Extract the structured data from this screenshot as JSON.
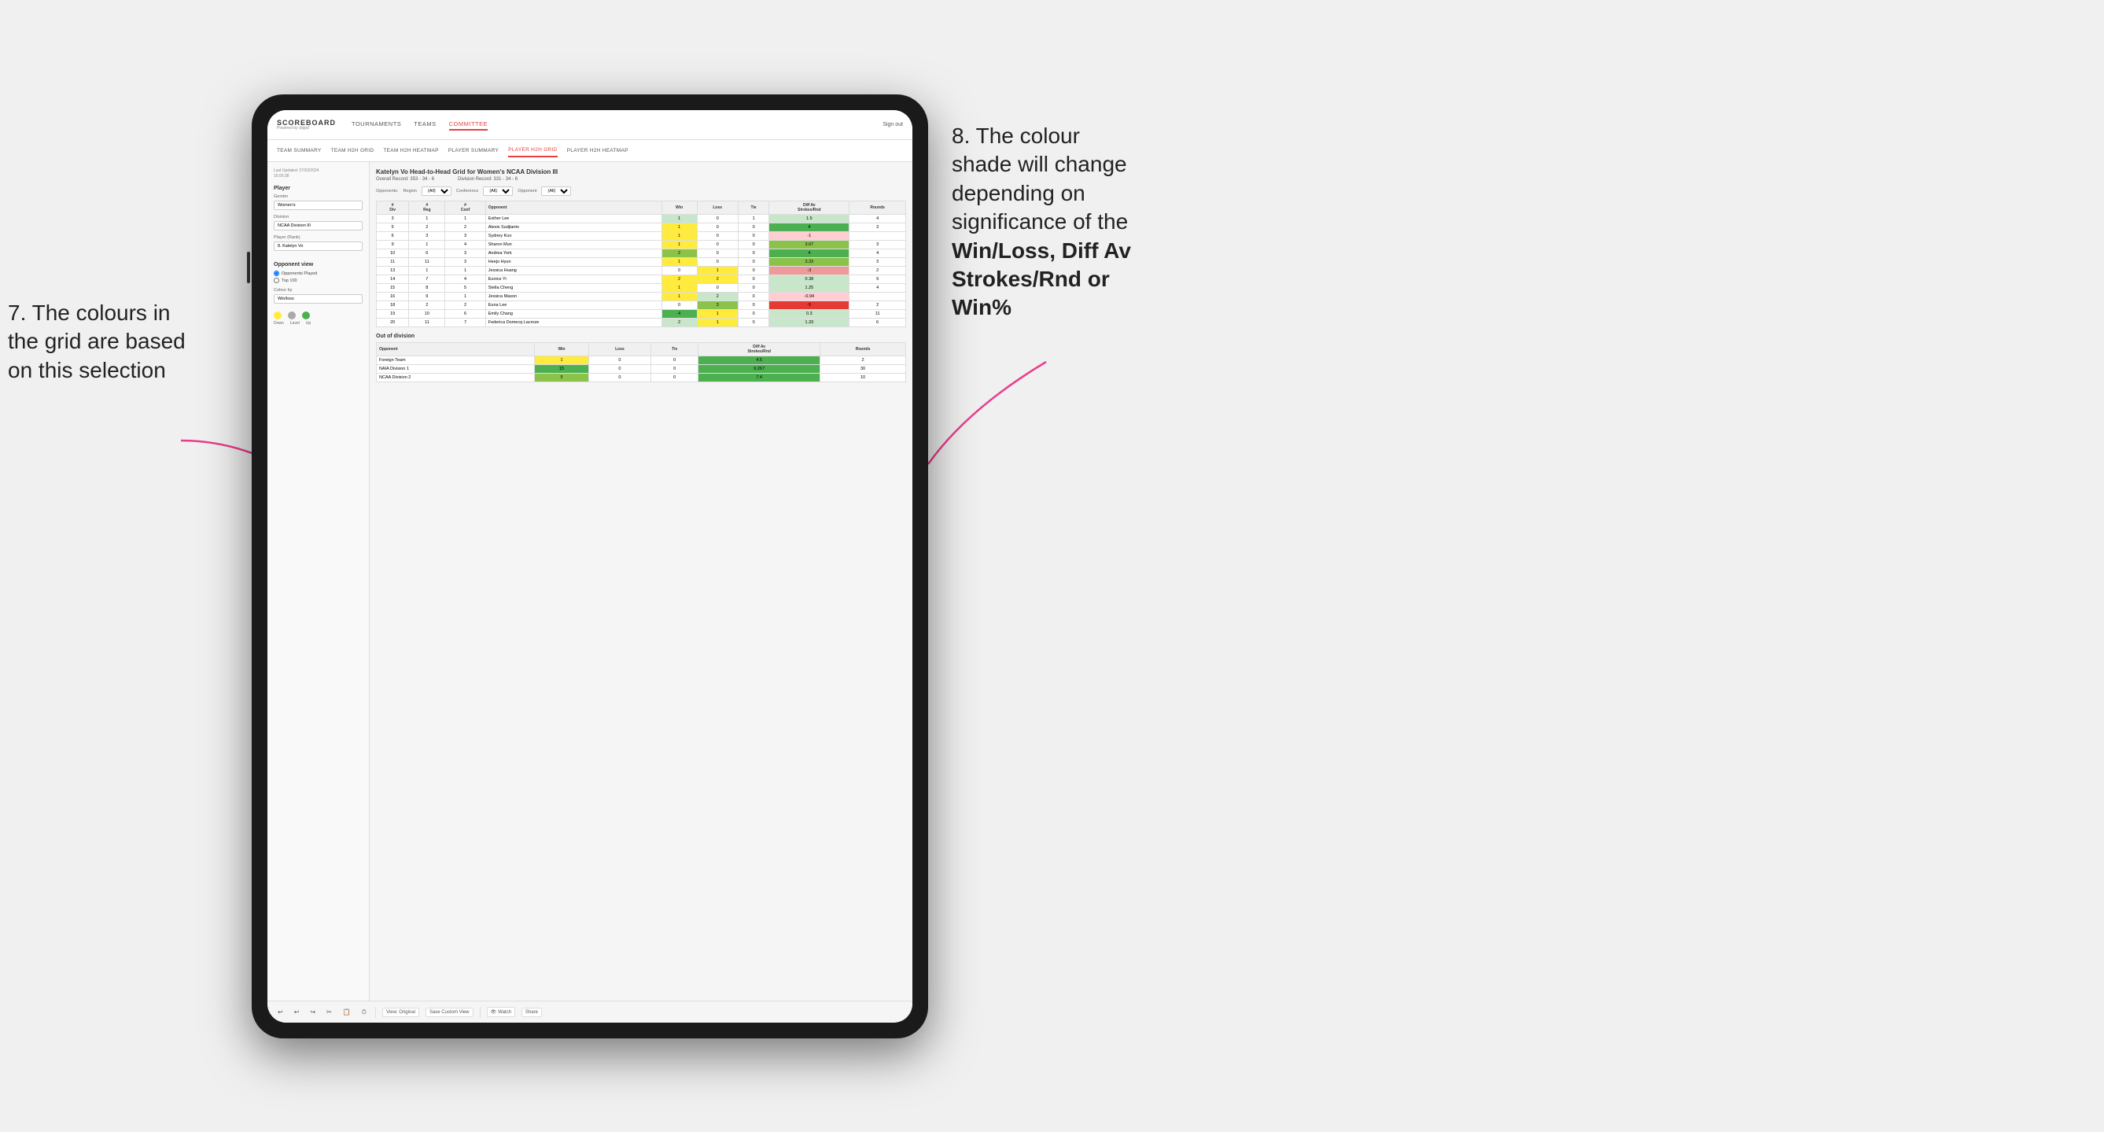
{
  "annotations": {
    "left": {
      "line1": "7. The colours in",
      "line2": "the grid are based",
      "line3": "on this selection"
    },
    "right": {
      "line1": "8. The colour",
      "line2": "shade will change",
      "line3": "depending on",
      "line4": "significance of the",
      "bold1": "Win/Loss",
      "comma": ", ",
      "bold2": "Diff Av",
      "line5": "Strokes/Rnd",
      "or": " or",
      "bold3": "Win%"
    }
  },
  "nav": {
    "logo": "SCOREBOARD",
    "logo_sub": "Powered by clippd",
    "items": [
      "TOURNAMENTS",
      "TEAMS",
      "COMMITTEE"
    ],
    "active": "COMMITTEE",
    "sign_out": "Sign out"
  },
  "sub_nav": {
    "items": [
      "TEAM SUMMARY",
      "TEAM H2H GRID",
      "TEAM H2H HEATMAP",
      "PLAYER SUMMARY",
      "PLAYER H2H GRID",
      "PLAYER H2H HEATMAP"
    ],
    "active": "PLAYER H2H GRID"
  },
  "left_panel": {
    "last_updated_label": "Last Updated: 27/03/2024",
    "last_updated_time": "16:55:38",
    "player_section": "Player",
    "gender_label": "Gender",
    "gender_value": "Women's",
    "division_label": "Division",
    "division_value": "NCAA Division III",
    "rank_label": "Player (Rank)",
    "rank_value": "8. Katelyn Vo",
    "opponent_view_label": "Opponent view",
    "radio_options": [
      "Opponents Played",
      "Top 100"
    ],
    "radio_selected": "Opponents Played",
    "colour_by_label": "Colour by",
    "colour_by_value": "Win/loss",
    "legend": {
      "down_label": "Down",
      "level_label": "Level",
      "up_label": "Up"
    }
  },
  "grid": {
    "title": "Katelyn Vo Head-to-Head Grid for Women's NCAA Division III",
    "overall_record_label": "Overall Record:",
    "overall_record": "353 - 34 - 6",
    "division_record_label": "Division Record:",
    "division_record": "331 - 34 - 6",
    "filter_label": "Opponents:",
    "filter_region_label": "Region",
    "filter_conf_label": "Conference",
    "filter_opp_label": "Opponent",
    "filter_all": "(All)",
    "col_headers": [
      "#\nDiv",
      "#\nReg",
      "#\nConf",
      "Opponent",
      "Win",
      "Loss",
      "Tie",
      "Diff Av\nStrokes/Rnd",
      "Rounds"
    ],
    "rows": [
      {
        "div": 3,
        "reg": 1,
        "conf": 1,
        "opponent": "Esther Lee",
        "win": 1,
        "loss": 0,
        "tie": 1,
        "diff": 1.5,
        "rounds": 4,
        "win_color": "green-light",
        "loss_color": "white",
        "tie_color": "white",
        "diff_color": "green-light"
      },
      {
        "div": 5,
        "reg": 2,
        "conf": 2,
        "opponent": "Alexis Sudjianto",
        "win": 1,
        "loss": 0,
        "tie": 0,
        "diff": 4.0,
        "rounds": 3,
        "win_color": "yellow",
        "loss_color": "white",
        "tie_color": "white",
        "diff_color": "green-dark"
      },
      {
        "div": 6,
        "reg": 3,
        "conf": 3,
        "opponent": "Sydney Kuo",
        "win": 1,
        "loss": 0,
        "tie": 0,
        "diff": -1.0,
        "rounds": "",
        "win_color": "yellow",
        "loss_color": "white",
        "tie_color": "white",
        "diff_color": "red-light"
      },
      {
        "div": 9,
        "reg": 1,
        "conf": 4,
        "opponent": "Sharon Mun",
        "win": 1,
        "loss": 0,
        "tie": 0,
        "diff": 3.67,
        "rounds": 3,
        "win_color": "yellow",
        "loss_color": "white",
        "tie_color": "white",
        "diff_color": "green-med"
      },
      {
        "div": 10,
        "reg": 6,
        "conf": 3,
        "opponent": "Andrea York",
        "win": 2,
        "loss": 0,
        "tie": 0,
        "diff": 4.0,
        "rounds": 4,
        "win_color": "green-med",
        "loss_color": "white",
        "tie_color": "white",
        "diff_color": "green-dark"
      },
      {
        "div": 11,
        "reg": 11,
        "conf": 3,
        "opponent": "Heejo Hyun",
        "win": 1,
        "loss": 0,
        "tie": 0,
        "diff": 3.33,
        "rounds": 3,
        "win_color": "yellow",
        "loss_color": "white",
        "tie_color": "white",
        "diff_color": "green-med"
      },
      {
        "div": 13,
        "reg": 1,
        "conf": 1,
        "opponent": "Jessica Huang",
        "win": 0,
        "loss": 1,
        "tie": 0,
        "diff": -3.0,
        "rounds": 2,
        "win_color": "white",
        "loss_color": "yellow",
        "tie_color": "white",
        "diff_color": "red-med"
      },
      {
        "div": 14,
        "reg": 7,
        "conf": 4,
        "opponent": "Eunice Yi",
        "win": 2,
        "loss": 2,
        "tie": 0,
        "diff": 0.38,
        "rounds": 9,
        "win_color": "yellow",
        "loss_color": "yellow",
        "tie_color": "white",
        "diff_color": "green-light"
      },
      {
        "div": 15,
        "reg": 8,
        "conf": 5,
        "opponent": "Stella Cheng",
        "win": 1,
        "loss": 0,
        "tie": 0,
        "diff": 1.25,
        "rounds": 4,
        "win_color": "yellow",
        "loss_color": "white",
        "tie_color": "white",
        "diff_color": "green-light"
      },
      {
        "div": 16,
        "reg": 9,
        "conf": 1,
        "opponent": "Jessica Mason",
        "win": 1,
        "loss": 2,
        "tie": 0,
        "diff": -0.94,
        "rounds": "",
        "win_color": "yellow",
        "loss_color": "green-light",
        "tie_color": "white",
        "diff_color": "red-light"
      },
      {
        "div": 18,
        "reg": 2,
        "conf": 2,
        "opponent": "Euna Lee",
        "win": 0,
        "loss": 3,
        "tie": 0,
        "diff": -5.0,
        "rounds": 2,
        "win_color": "white",
        "loss_color": "green-med",
        "tie_color": "white",
        "diff_color": "red-dark"
      },
      {
        "div": 19,
        "reg": 10,
        "conf": 6,
        "opponent": "Emily Chang",
        "win": 4,
        "loss": 1,
        "tie": 0,
        "diff": 0.3,
        "rounds": 11,
        "win_color": "green-dark",
        "loss_color": "yellow",
        "tie_color": "white",
        "diff_color": "green-light"
      },
      {
        "div": 20,
        "reg": 11,
        "conf": 7,
        "opponent": "Federica Domecq Lacroze",
        "win": 2,
        "loss": 1,
        "tie": 0,
        "diff": 1.33,
        "rounds": 6,
        "win_color": "green-light",
        "loss_color": "yellow",
        "tie_color": "white",
        "diff_color": "green-light"
      }
    ],
    "out_of_division": {
      "title": "Out of division",
      "rows": [
        {
          "opponent": "Foreign Team",
          "win": 1,
          "loss": 0,
          "tie": 0,
          "diff": 4.5,
          "rounds": 2,
          "win_color": "yellow",
          "diff_color": "green-dark"
        },
        {
          "opponent": "NAIA Division 1",
          "win": 15,
          "loss": 0,
          "tie": 0,
          "diff": 9.267,
          "rounds": 30,
          "win_color": "green-dark",
          "diff_color": "green-dark"
        },
        {
          "opponent": "NCAA Division 2",
          "win": 5,
          "loss": 0,
          "tie": 0,
          "diff": 7.4,
          "rounds": 10,
          "win_color": "green-med",
          "diff_color": "green-dark"
        }
      ]
    }
  },
  "toolbar": {
    "buttons": [
      "View: Original",
      "Save Custom View",
      "Watch",
      "Share"
    ]
  }
}
